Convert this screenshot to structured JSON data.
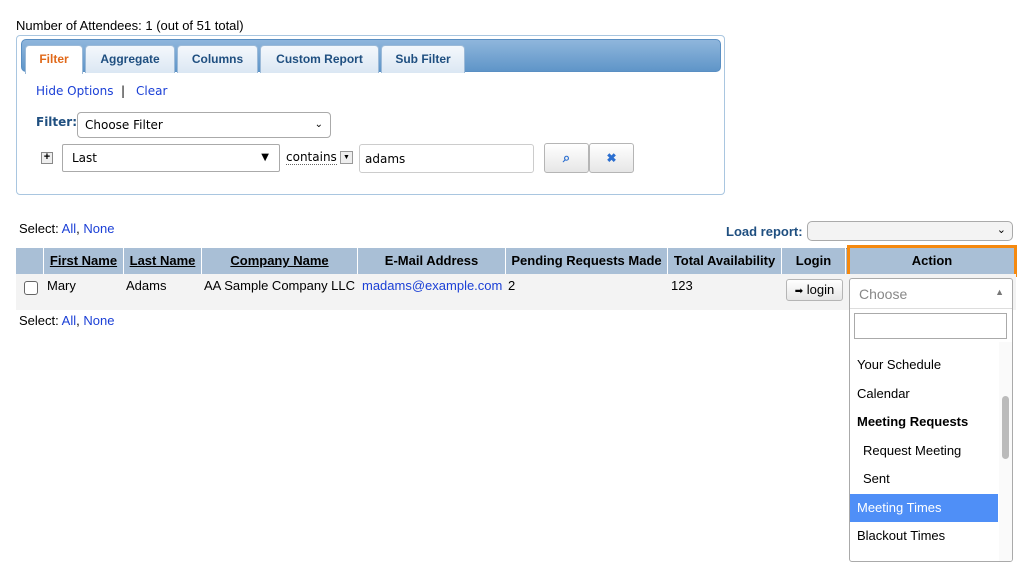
{
  "summary": "Number of Attendees: 1 (out of 51 total)",
  "filter_panel": {
    "tabs": [
      {
        "label": "Filter"
      },
      {
        "label": "Aggregate"
      },
      {
        "label": "Columns"
      },
      {
        "label": "Custom Report"
      },
      {
        "label": "Sub Filter"
      }
    ],
    "hide_options": "Hide Options",
    "separator": "|",
    "clear": "Clear",
    "filter_label": "Filter:",
    "filter_select": "Choose Filter",
    "field_select": "Last",
    "operator": "contains",
    "value": "adams"
  },
  "select_top": {
    "label": "Select:",
    "all": "All",
    "comma": ",",
    "none": "None"
  },
  "select_bottom": {
    "label": "Select:",
    "all": "All",
    "comma": ",",
    "none": "None"
  },
  "load_report": {
    "label": "Load report:",
    "value": ""
  },
  "table": {
    "columns": [
      "First Name",
      "Last Name",
      "Company Name",
      "E-Mail Address",
      "Pending Requests Made",
      "Total Availability",
      "Login",
      "Action"
    ],
    "rows": [
      {
        "first": "Mary",
        "last": "Adams",
        "company": "AA Sample Company LLC",
        "email": "madams@example.com",
        "pending": "2",
        "availability": "123",
        "login": "login"
      }
    ]
  },
  "action_dropdown": {
    "placeholder": "Choose",
    "search_value": "",
    "options": [
      {
        "label": "Your Schedule"
      },
      {
        "label": "Calendar"
      },
      {
        "label": "Meeting Requests"
      },
      {
        "label": "Request Meeting"
      },
      {
        "label": "Sent"
      },
      {
        "label": "Meeting Times"
      },
      {
        "label": "Blackout Times"
      }
    ]
  },
  "colors": {
    "header": "#a9bfd6",
    "highlight": "#4f8ff7",
    "focus_outline": "#f5890f",
    "active_tab": "#e0691a"
  }
}
